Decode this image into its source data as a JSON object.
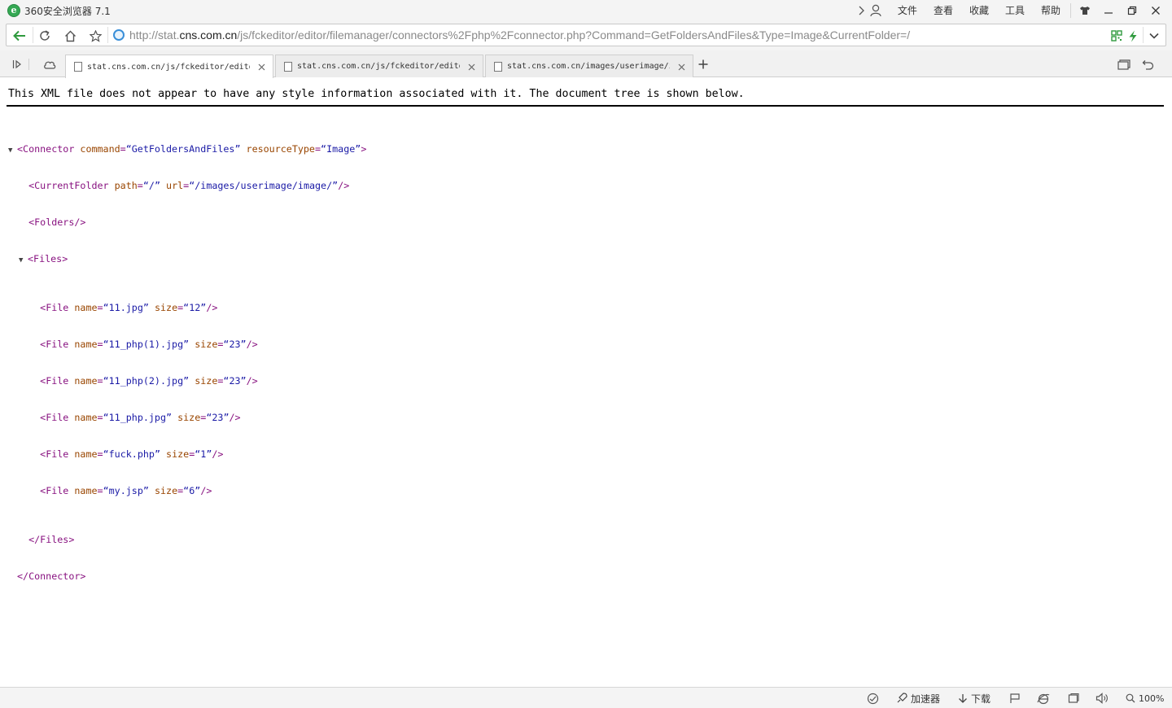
{
  "window": {
    "title": "360安全浏览器 7.1",
    "menu": [
      "文件",
      "查看",
      "收藏",
      "工具",
      "帮助"
    ]
  },
  "address_bar": {
    "url_prefix": "http://stat.",
    "url_host": "cns.com.cn",
    "url_rest": "/js/fckeditor/editor/filemanager/connectors%2Fphp%2Fconnector.php?Command=GetFoldersAndFiles&Type=Image&CurrentFolder=/"
  },
  "tabs": [
    {
      "label": "stat.cns.com.cn/js/fckeditor/editor/filemanager",
      "active": true
    },
    {
      "label": "stat.cns.com.cn/js/fckeditor/editor/filemanager",
      "active": false
    },
    {
      "label": "stat.cns.com.cn/images/userimage/image/",
      "active": false
    }
  ],
  "page": {
    "notice": "This XML file does not appear to have any style information associated with it. The document tree is shown below.",
    "xml": {
      "connector_command": "GetFoldersAndFiles",
      "connector_resource_type": "Image",
      "current_folder_path": "/",
      "current_folder_url": "/images/userimage/image/",
      "files": [
        {
          "name": "11.jpg",
          "size": "12"
        },
        {
          "name": "11_php(1).jpg",
          "size": "23"
        },
        {
          "name": "11_php(2).jpg",
          "size": "23"
        },
        {
          "name": "11_php.jpg",
          "size": "23"
        },
        {
          "name": "fuck.php",
          "size": "1"
        },
        {
          "name": "my.jsp",
          "size": "6"
        }
      ]
    }
  },
  "status_bar": {
    "accelerator": "加速器",
    "download": "下载",
    "zoom": "100%"
  }
}
